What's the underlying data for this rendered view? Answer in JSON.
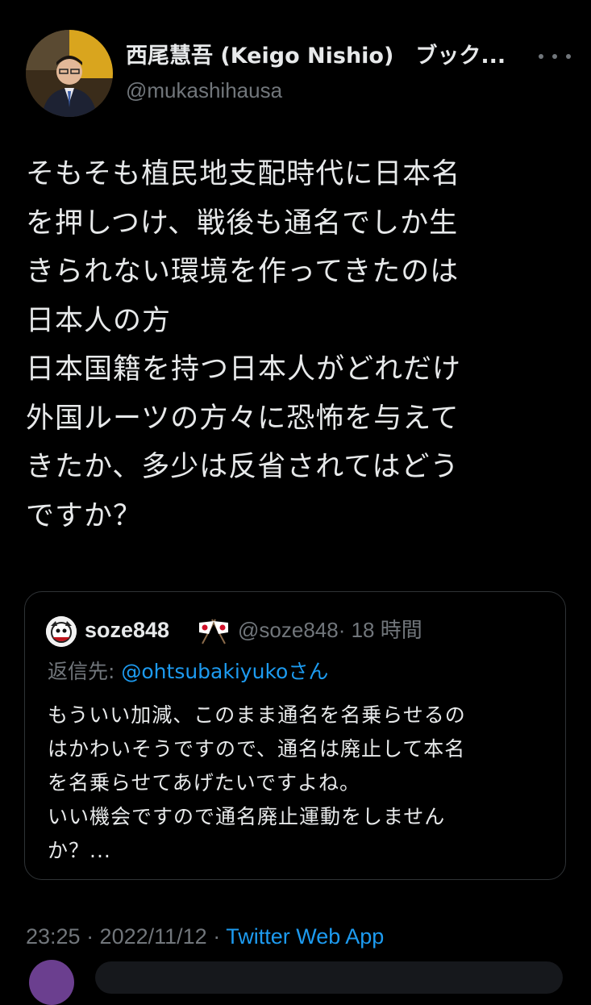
{
  "tweet": {
    "author_name": "西尾慧吾 (Keigo Nishio)　ブック...",
    "author_handle": "@mukashihausa",
    "text_lines": [
      "そもそも植民地支配時代に日本名",
      "を押しつけ、戦後も通名でしか生",
      "きられない環境を作ってきたのは",
      "日本人の方",
      "日本国籍を持つ日本人がどれだけ",
      "外国ルーツの方々に恐怖を与えて",
      "きたか、多少は反省されてはどう",
      "ですか？"
    ],
    "more_icon": "more-horizontal-icon"
  },
  "quote": {
    "author_name": "soze848",
    "flags_icon": "crossed-japanese-flags-icon",
    "author_handle": "@soze848",
    "time_ago": "· 18 時間",
    "reply_label": "返信先: ",
    "reply_mention": "@ohtsubakiyuko",
    "reply_suffix": "さん",
    "text_lines": [
      "もういい加減、このまま通名を名乗らせるの",
      "はかわいそうですので、通名は廃止して本名",
      "を名乗らせてあげたいですよね。",
      "いい機会ですので通名廃止運動をしません",
      "か？..."
    ]
  },
  "meta": {
    "time": "23:25 · 2022/11/12 · ",
    "source": "Twitter Web App"
  },
  "colors": {
    "background": "#000000",
    "text": "#e7e9ea",
    "secondary": "#71767b",
    "accent": "#1d9bf0",
    "border": "#2f3336"
  }
}
